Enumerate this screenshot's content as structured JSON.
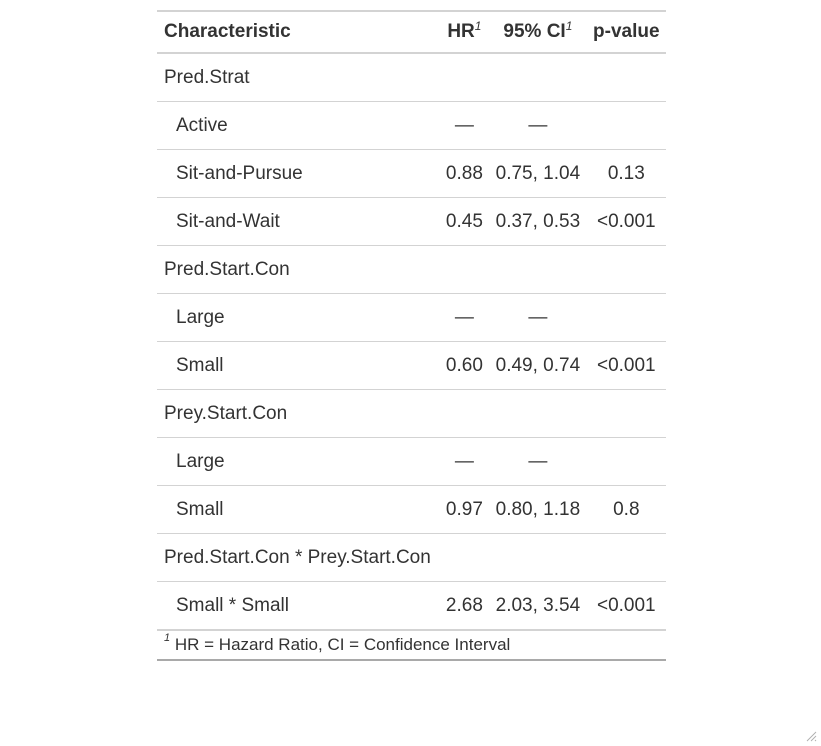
{
  "table": {
    "headers": {
      "characteristic": "Characteristic",
      "hr": "HR",
      "hr_mark": "1",
      "ci": "95% CI",
      "ci_mark": "1",
      "pvalue": "p-value"
    },
    "rows": [
      {
        "label": "Pred.Strat",
        "hr": "",
        "ci": "",
        "p": ""
      },
      {
        "label": "Active",
        "hr": "—",
        "ci": "—",
        "p": ""
      },
      {
        "label": "Sit-and-Pursue",
        "hr": "0.88",
        "ci": "0.75, 1.04",
        "p": "0.13"
      },
      {
        "label": "Sit-and-Wait",
        "hr": "0.45",
        "ci": "0.37, 0.53",
        "p": "<0.001"
      },
      {
        "label": "Pred.Start.Con",
        "hr": "",
        "ci": "",
        "p": ""
      },
      {
        "label": "Large",
        "hr": "—",
        "ci": "—",
        "p": ""
      },
      {
        "label": "Small",
        "hr": "0.60",
        "ci": "0.49, 0.74",
        "p": "<0.001"
      },
      {
        "label": "Prey.Start.Con",
        "hr": "",
        "ci": "",
        "p": ""
      },
      {
        "label": "Large",
        "hr": "—",
        "ci": "—",
        "p": ""
      },
      {
        "label": "Small",
        "hr": "0.97",
        "ci": "0.80, 1.18",
        "p": "0.8"
      },
      {
        "label": "Pred.Start.Con * Prey.Start.Con",
        "hr": "",
        "ci": "",
        "p": ""
      },
      {
        "label": "Small * Small",
        "hr": "2.68",
        "ci": "2.03, 3.54",
        "p": "<0.001"
      }
    ],
    "footnote_mark": "1",
    "footnote_text": "HR = Hazard Ratio, CI = Confidence Interval"
  },
  "icons": {
    "resize_grip": "resize-grip-icon"
  },
  "colors": {
    "text": "#333333",
    "rule": "#d3d3d3",
    "footnote_rule": "#a9a9a9"
  }
}
